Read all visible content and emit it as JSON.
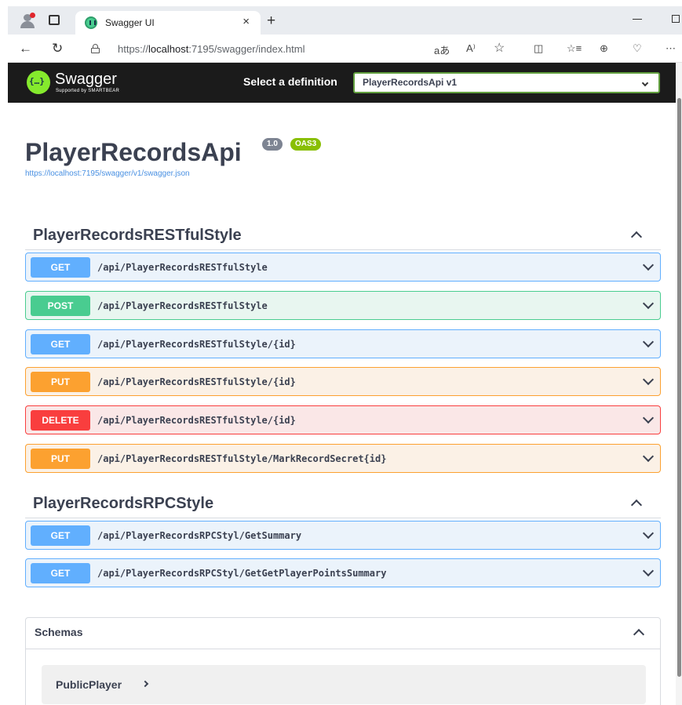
{
  "browser": {
    "tab_title": "Swagger UI",
    "tab_close": "×",
    "new_tab": "+",
    "url_plain_prefix": "https://",
    "url_host": "localhost",
    "url_rest": ":7195/swagger/index.html",
    "read_aloud": "aあ",
    "aa": "A⁾"
  },
  "topbar": {
    "logo_text": "Swagger",
    "logo_sub": "Supported by SMARTBEAR",
    "select_label": "Select a definition",
    "selected_definition": "PlayerRecordsApi v1"
  },
  "info": {
    "title": "PlayerRecordsApi",
    "version": "1.0",
    "oas": "OAS3",
    "spec_url": "https://localhost:7195/swagger/v1/swagger.json"
  },
  "tags": [
    {
      "name": "PlayerRecordsRESTfulStyle",
      "operations": [
        {
          "method": "GET",
          "path": "/api/PlayerRecordsRESTfulStyle"
        },
        {
          "method": "POST",
          "path": "/api/PlayerRecordsRESTfulStyle"
        },
        {
          "method": "GET",
          "path": "/api/PlayerRecordsRESTfulStyle/{id}"
        },
        {
          "method": "PUT",
          "path": "/api/PlayerRecordsRESTfulStyle/{id}"
        },
        {
          "method": "DELETE",
          "path": "/api/PlayerRecordsRESTfulStyle/{id}"
        },
        {
          "method": "PUT",
          "path": "/api/PlayerRecordsRESTfulStyle/MarkRecordSecret{id}"
        }
      ]
    },
    {
      "name": "PlayerRecordsRPCStyle",
      "operations": [
        {
          "method": "GET",
          "path": "/api/PlayerRecordsRPCStyl/GetSummary"
        },
        {
          "method": "GET",
          "path": "/api/PlayerRecordsRPCStyl/GetGetPlayerPointsSummary"
        }
      ]
    }
  ],
  "schemas": {
    "title": "Schemas",
    "models": [
      "PublicPlayer"
    ]
  },
  "colors": {
    "get": "#61affe",
    "post": "#49cc90",
    "put": "#fca130",
    "delete": "#f93e3e",
    "topbar": "#1b1b1b",
    "logo": "#85ea2d"
  }
}
